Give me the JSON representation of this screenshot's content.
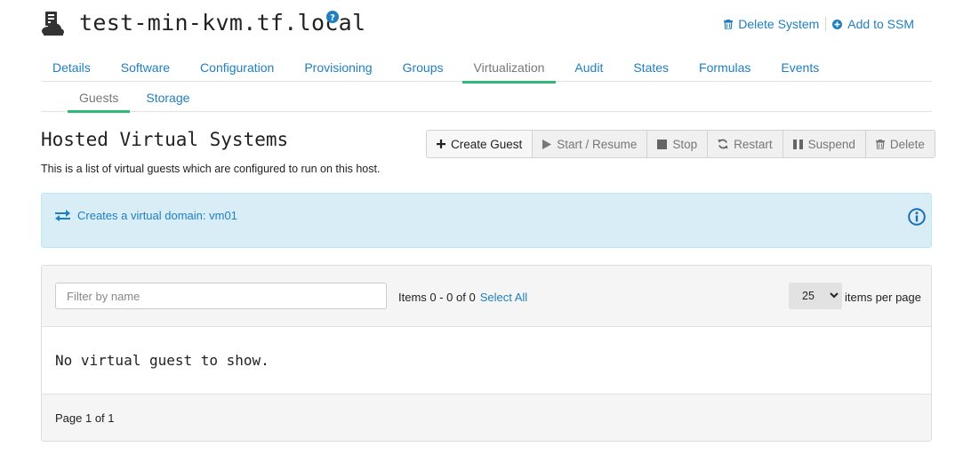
{
  "header": {
    "title": "test-min-kvm.tf.local",
    "actions": {
      "delete_system": "Delete System",
      "add_to_ssm": "Add to SSM"
    }
  },
  "tabs": [
    {
      "label": "Details"
    },
    {
      "label": "Software"
    },
    {
      "label": "Configuration"
    },
    {
      "label": "Provisioning"
    },
    {
      "label": "Groups"
    },
    {
      "label": "Virtualization",
      "active": true
    },
    {
      "label": "Audit"
    },
    {
      "label": "States"
    },
    {
      "label": "Formulas"
    },
    {
      "label": "Events"
    }
  ],
  "subtabs": [
    {
      "label": "Guests",
      "active": true
    },
    {
      "label": "Storage"
    }
  ],
  "main": {
    "title": "Hosted Virtual Systems",
    "description": "This is a list of virtual guests which are configured to run on this host."
  },
  "toolbar": {
    "create_guest": "Create Guest",
    "start_resume": "Start / Resume",
    "stop": "Stop",
    "restart": "Restart",
    "suspend": "Suspend",
    "delete": "Delete"
  },
  "alert": {
    "text": "Creates a virtual domain: vm01"
  },
  "table": {
    "filter_placeholder": "Filter by name",
    "items_count": "Items 0 - 0 of 0",
    "select_all": "Select All",
    "per_page_value": "25",
    "per_page_label": "items per page",
    "empty_message": "No virtual guest to show.",
    "page_info": "Page 1 of 1"
  },
  "colors": {
    "link": "#1f7fbf",
    "active_tab_underline": "#30ba78",
    "alert_bg": "#d9edf7"
  }
}
